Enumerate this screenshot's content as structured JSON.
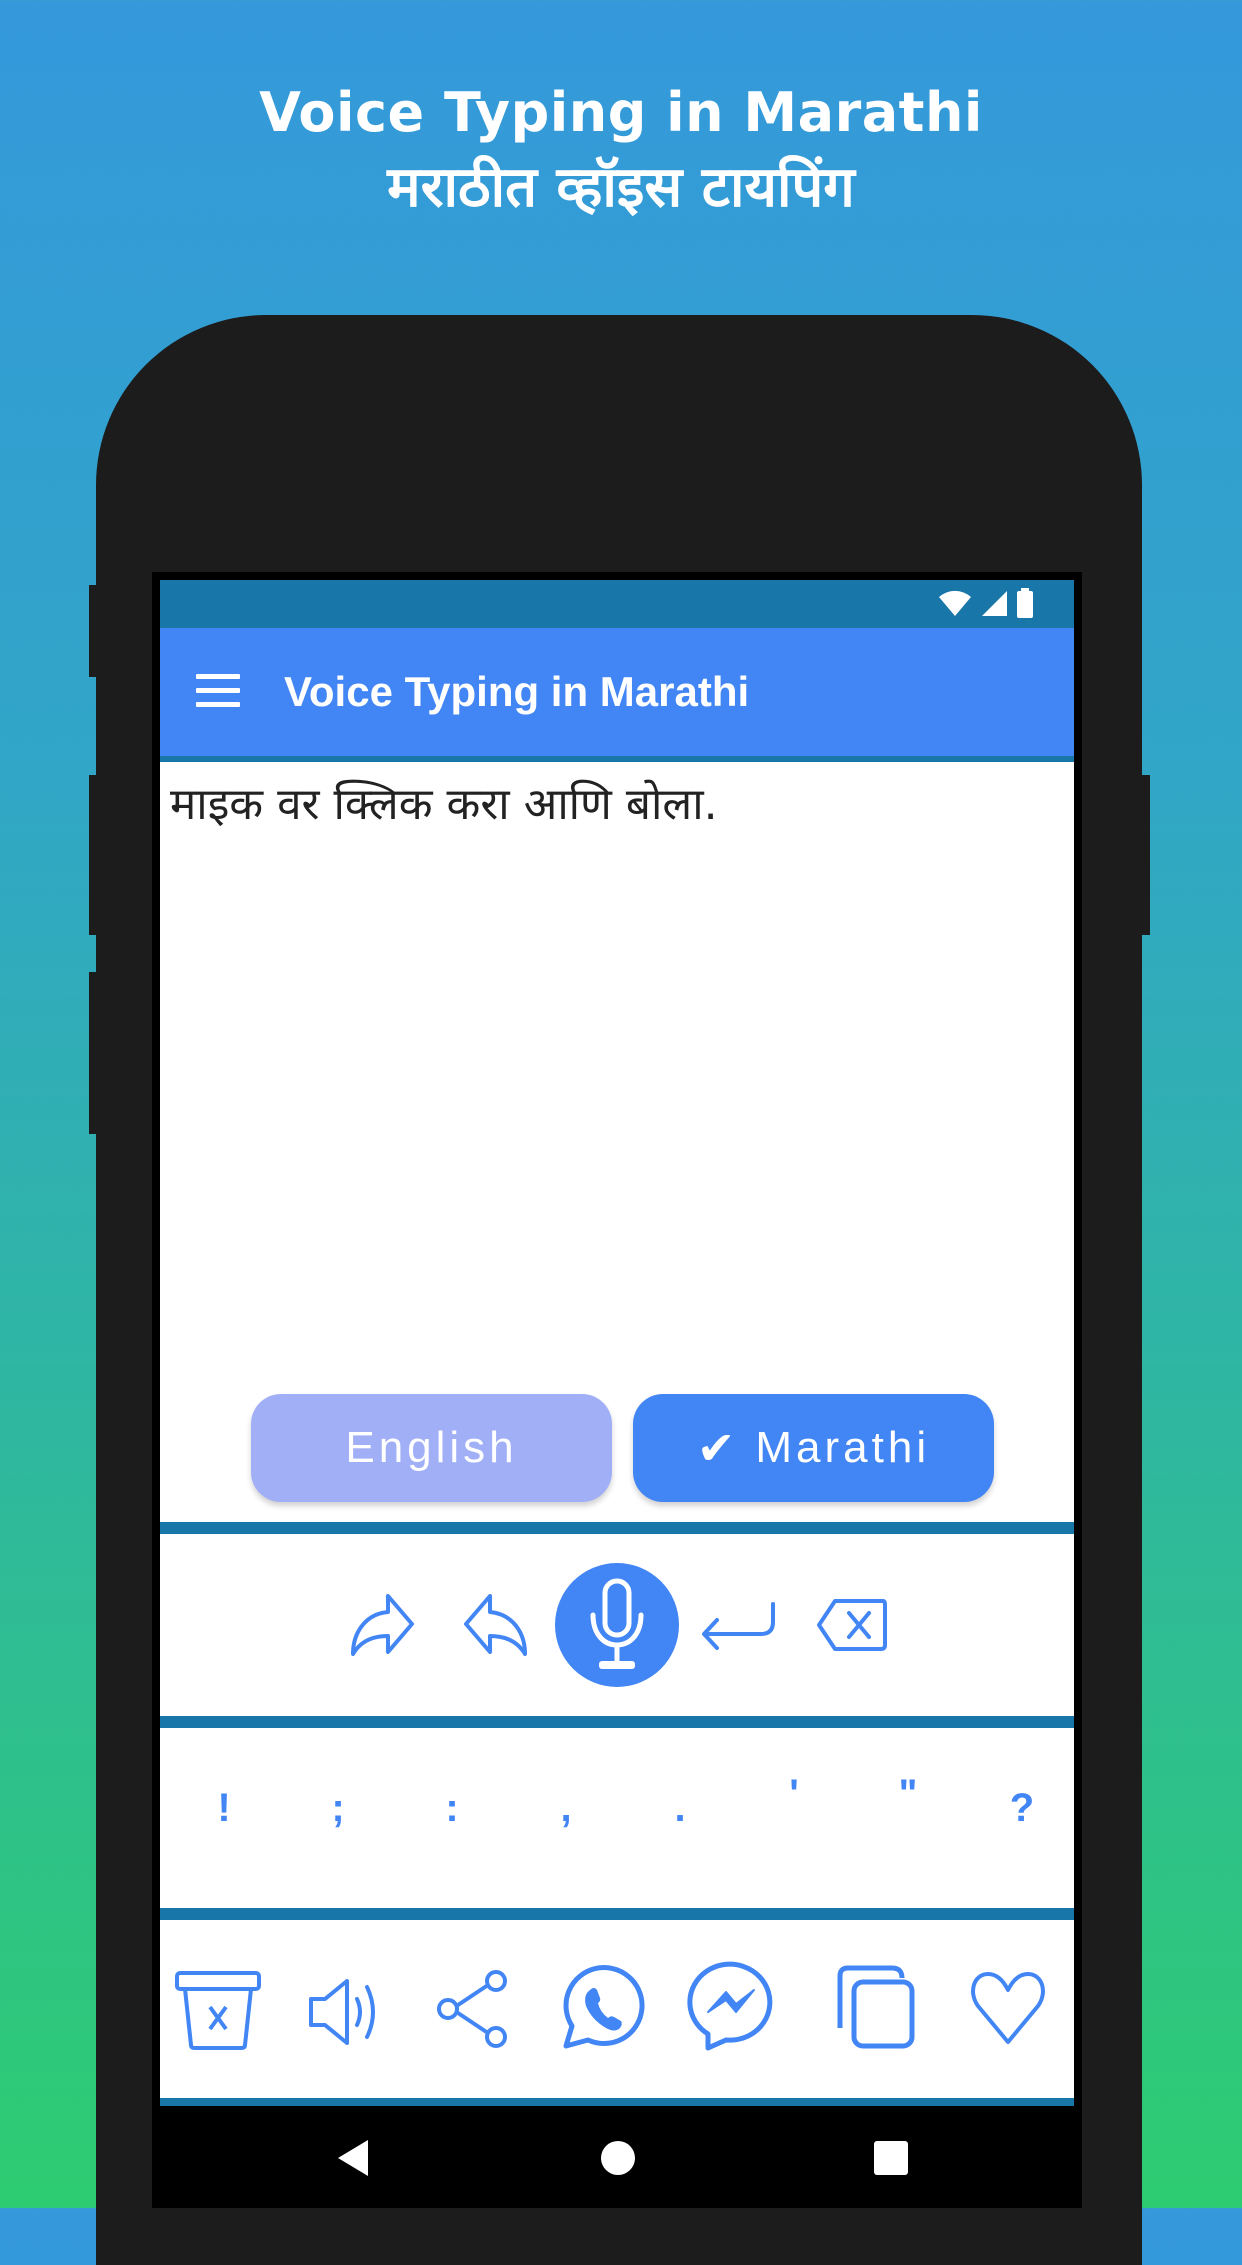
{
  "hero": {
    "title_en": "Voice Typing in Marathi",
    "title_mr": "मराठीत व्हॉइस टायपिंग"
  },
  "status_bar": {
    "icons": [
      "wifi-icon",
      "cell-signal-icon",
      "battery-icon"
    ]
  },
  "app_bar": {
    "menu_icon": "hamburger-menu-icon",
    "title": "Voice Typing in Marathi"
  },
  "editor": {
    "text": "माइक वर क्लिक करा आणि बोला."
  },
  "language_toggle": {
    "options": [
      {
        "label": "English",
        "selected": false
      },
      {
        "label": "Marathi",
        "selected": true,
        "check": "✔"
      }
    ]
  },
  "controls": [
    {
      "name": "redo",
      "icon": "redo-icon"
    },
    {
      "name": "undo",
      "icon": "undo-icon"
    },
    {
      "name": "microphone",
      "icon": "microphone-icon"
    },
    {
      "name": "new-line",
      "icon": "enter-icon"
    },
    {
      "name": "backspace",
      "icon": "backspace-icon"
    }
  ],
  "punctuation": [
    "!",
    ";",
    ":",
    ",",
    ".",
    "'",
    "\"",
    "?"
  ],
  "actions": [
    {
      "name": "clear",
      "icon": "trash-icon"
    },
    {
      "name": "speak",
      "icon": "speaker-icon"
    },
    {
      "name": "share",
      "icon": "share-icon"
    },
    {
      "name": "whatsapp",
      "icon": "whatsapp-icon"
    },
    {
      "name": "messenger",
      "icon": "messenger-icon"
    },
    {
      "name": "copy",
      "icon": "copy-icon"
    },
    {
      "name": "favorite",
      "icon": "heart-icon"
    }
  ],
  "nav_bar": {
    "buttons": [
      "back-icon",
      "home-icon",
      "recents-icon"
    ]
  },
  "colors": {
    "accent": "#4285f4",
    "status_bar": "#1976a8",
    "english_inactive": "#a1aff7",
    "bg_top": "#3498db",
    "bg_bottom": "#2ecc71"
  }
}
